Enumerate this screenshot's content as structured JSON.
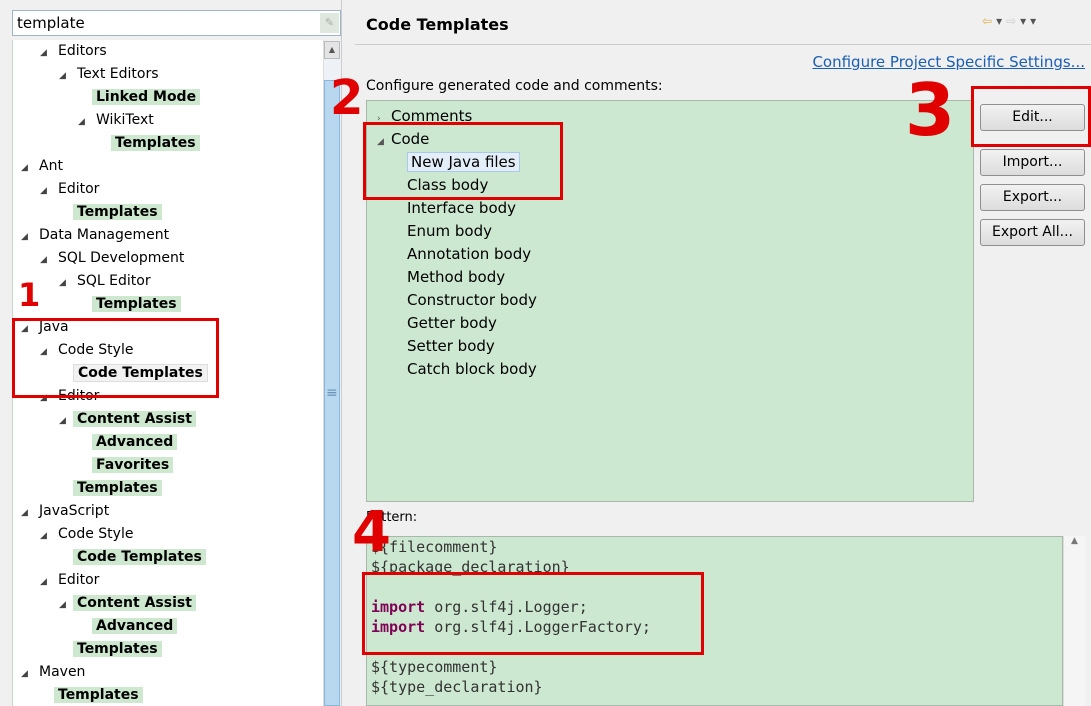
{
  "search": {
    "value": "template"
  },
  "tree": [
    {
      "label": "Editors",
      "level": 1,
      "expanded": true,
      "bold": false
    },
    {
      "label": "Text Editors",
      "level": 2,
      "expanded": true,
      "bold": false
    },
    {
      "label": "Linked Mode",
      "level": 3,
      "expanded": false,
      "bold": true
    },
    {
      "label": "WikiText",
      "level": 3,
      "expanded": true,
      "bold": false
    },
    {
      "label": "Templates",
      "level": 4,
      "expanded": false,
      "bold": true
    },
    {
      "label": "Ant",
      "level": 0,
      "expanded": true,
      "bold": false
    },
    {
      "label": "Editor",
      "level": 1,
      "expanded": true,
      "bold": false
    },
    {
      "label": "Templates",
      "level": 2,
      "expanded": false,
      "bold": true
    },
    {
      "label": "Data Management",
      "level": 0,
      "expanded": true,
      "bold": false
    },
    {
      "label": "SQL Development",
      "level": 1,
      "expanded": true,
      "bold": false
    },
    {
      "label": "SQL Editor",
      "level": 2,
      "expanded": true,
      "bold": false
    },
    {
      "label": "Templates",
      "level": 3,
      "expanded": false,
      "bold": true
    },
    {
      "label": "Java",
      "level": 0,
      "expanded": true,
      "bold": false
    },
    {
      "label": "Code Style",
      "level": 1,
      "expanded": true,
      "bold": false
    },
    {
      "label": "Code Templates",
      "level": 2,
      "expanded": false,
      "bold": true,
      "selected": true
    },
    {
      "label": "Editor",
      "level": 1,
      "expanded": true,
      "bold": false
    },
    {
      "label": "Content Assist",
      "level": 2,
      "expanded": true,
      "bold": true
    },
    {
      "label": "Advanced",
      "level": 3,
      "expanded": false,
      "bold": true
    },
    {
      "label": "Favorites",
      "level": 3,
      "expanded": false,
      "bold": true
    },
    {
      "label": "Templates",
      "level": 2,
      "expanded": false,
      "bold": true
    },
    {
      "label": "JavaScript",
      "level": 0,
      "expanded": true,
      "bold": false
    },
    {
      "label": "Code Style",
      "level": 1,
      "expanded": true,
      "bold": false
    },
    {
      "label": "Code Templates",
      "level": 2,
      "expanded": false,
      "bold": true
    },
    {
      "label": "Editor",
      "level": 1,
      "expanded": true,
      "bold": false
    },
    {
      "label": "Content Assist",
      "level": 2,
      "expanded": true,
      "bold": true
    },
    {
      "label": "Advanced",
      "level": 3,
      "expanded": false,
      "bold": true
    },
    {
      "label": "Templates",
      "level": 2,
      "expanded": false,
      "bold": true
    },
    {
      "label": "Maven",
      "level": 0,
      "expanded": true,
      "bold": false
    },
    {
      "label": "Templates",
      "level": 1,
      "expanded": false,
      "bold": true
    }
  ],
  "page": {
    "title": "Code Templates",
    "link": "Configure Project Specific Settings...",
    "configure_label": "Configure generated code and comments:",
    "pattern_label": "Pattern:"
  },
  "template_tree": [
    {
      "label": "Comments",
      "level": 0,
      "arrow": "collapsed"
    },
    {
      "label": "Code",
      "level": 0,
      "arrow": "expanded"
    },
    {
      "label": "New Java files",
      "level": 1,
      "selected": true
    },
    {
      "label": "Class body",
      "level": 1
    },
    {
      "label": "Interface body",
      "level": 1
    },
    {
      "label": "Enum body",
      "level": 1
    },
    {
      "label": "Annotation body",
      "level": 1
    },
    {
      "label": "Method body",
      "level": 1
    },
    {
      "label": "Constructor body",
      "level": 1
    },
    {
      "label": "Getter body",
      "level": 1
    },
    {
      "label": "Setter body",
      "level": 1
    },
    {
      "label": "Catch block body",
      "level": 1
    }
  ],
  "buttons": [
    "Edit...",
    "Import...",
    "Export...",
    "Export All..."
  ],
  "pattern_lines": [
    {
      "kw": "",
      "text": "${filecomment}"
    },
    {
      "kw": "",
      "text": "${package_declaration}"
    },
    {
      "kw": "",
      "text": ""
    },
    {
      "kw": "import",
      "text": " org.slf4j.Logger;"
    },
    {
      "kw": "import",
      "text": " org.slf4j.LoggerFactory;"
    },
    {
      "kw": "",
      "text": ""
    },
    {
      "kw": "",
      "text": "${typecomment}"
    },
    {
      "kw": "",
      "text": "${type_declaration}"
    }
  ],
  "annotations": [
    "1",
    "2",
    "3",
    "4"
  ],
  "colors": {
    "annotation": "#e00000",
    "tree_match": "#cde8cf",
    "keyword": "#7f0055",
    "link": "#1a5fb4"
  }
}
